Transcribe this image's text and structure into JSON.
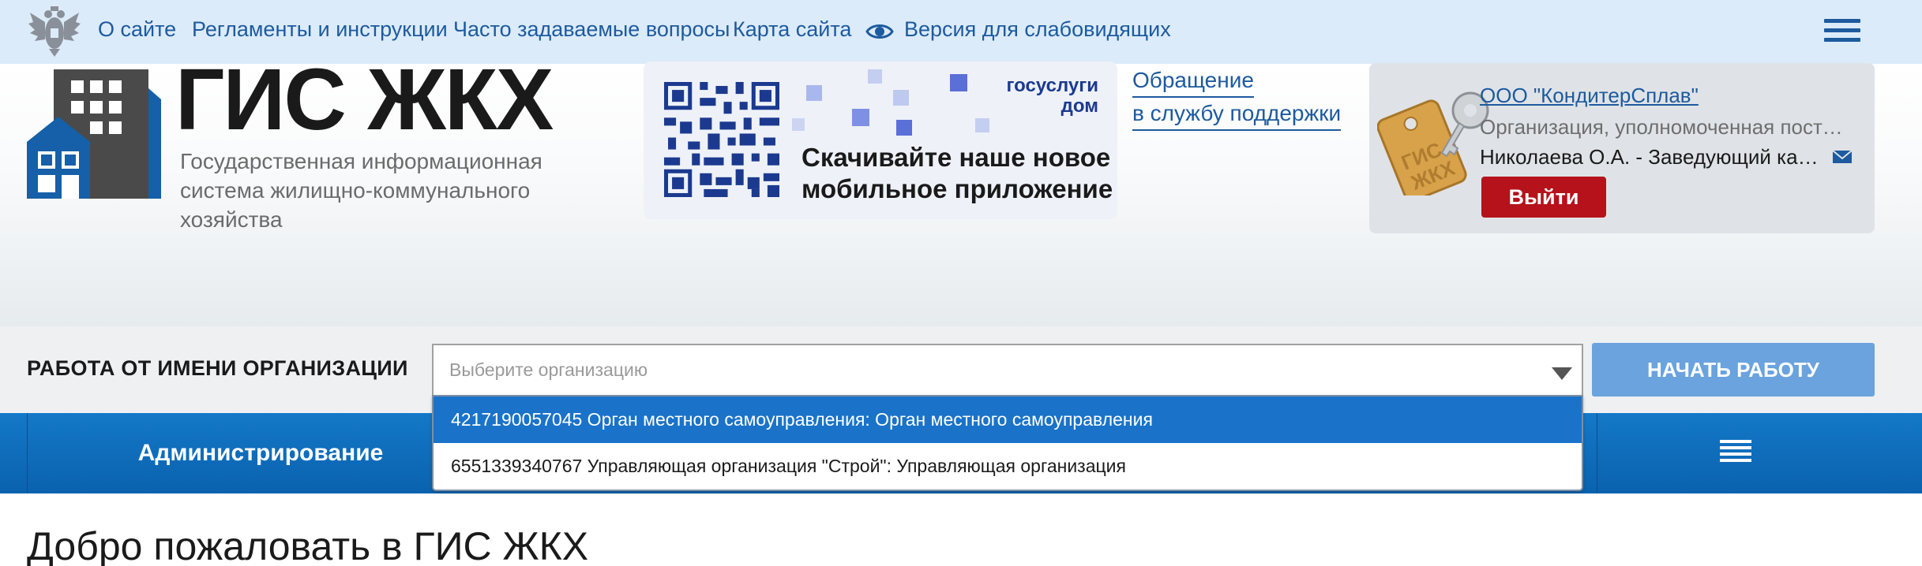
{
  "top_nav": {
    "links": [
      "О сайте",
      "Регламенты и инструкции",
      "Часто задаваемые вопросы",
      "Карта сайта"
    ],
    "accessibility_label": "Версия для слабовидящих"
  },
  "logo": {
    "title": "ГИС ЖКХ",
    "subtitle": "Государственная информационная система жилищно-коммунального хозяйства"
  },
  "banner": {
    "brand_line1": "госуслуги",
    "brand_line2": "дом",
    "cta_line1": "Скачивайте наше новое",
    "cta_line2": "мобильное приложение"
  },
  "support": {
    "line1": "Обращение",
    "line2": "в службу поддержки"
  },
  "user": {
    "org_name": "ООО \"КондитерСплав\"",
    "org_role": "Организация, уполномоченная поставщ...",
    "person": "Николаева О.А. - Заведующий канце...",
    "logout_label": "Выйти"
  },
  "org_bar": {
    "label": "РАБОТА ОТ ИМЕНИ ОРГАНИЗАЦИИ",
    "placeholder": "Выберите организацию",
    "start_label": "НАЧАТЬ РАБОТУ",
    "options": [
      "4217190057045 Орган местного самоуправления: Орган местного самоуправления",
      "6551339340767 Управляющая организация \"Строй\": Управляющая организация"
    ]
  },
  "nav": {
    "admin_label": "Администрирование"
  },
  "welcome": "Добро пожаловать в ГИС ЖКХ",
  "colors": {
    "topbar_bg": "#dcebf9",
    "link": "#1d5a9e",
    "nav_blue": "#1478c8",
    "logout_red": "#b5121b",
    "start_button": "#6aa3de",
    "selected_option": "#1a73c9"
  }
}
